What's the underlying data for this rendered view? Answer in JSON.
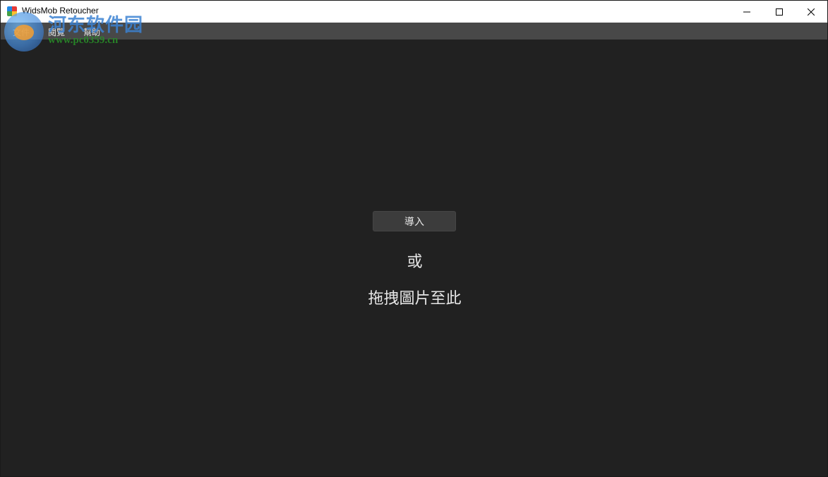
{
  "window": {
    "title": "WidsMob Retoucher",
    "controls": {
      "minimize_icon": "minimize-icon",
      "maximize_icon": "maximize-icon",
      "close_icon": "close-icon"
    }
  },
  "menu": {
    "items": [
      {
        "label": "文件"
      },
      {
        "label": "閱覽"
      },
      {
        "label": "幫助"
      }
    ]
  },
  "main": {
    "import_label": "導入",
    "or_text": "或",
    "drag_text": "拖拽圖片至此"
  },
  "watermark": {
    "title": "河东软件园",
    "url": "www.pc0359.cn"
  },
  "colors": {
    "background": "#212121",
    "menubar": "#484848",
    "titlebar": "#ffffff",
    "button": "#3c3c3c",
    "text": "#e6e6e6"
  }
}
